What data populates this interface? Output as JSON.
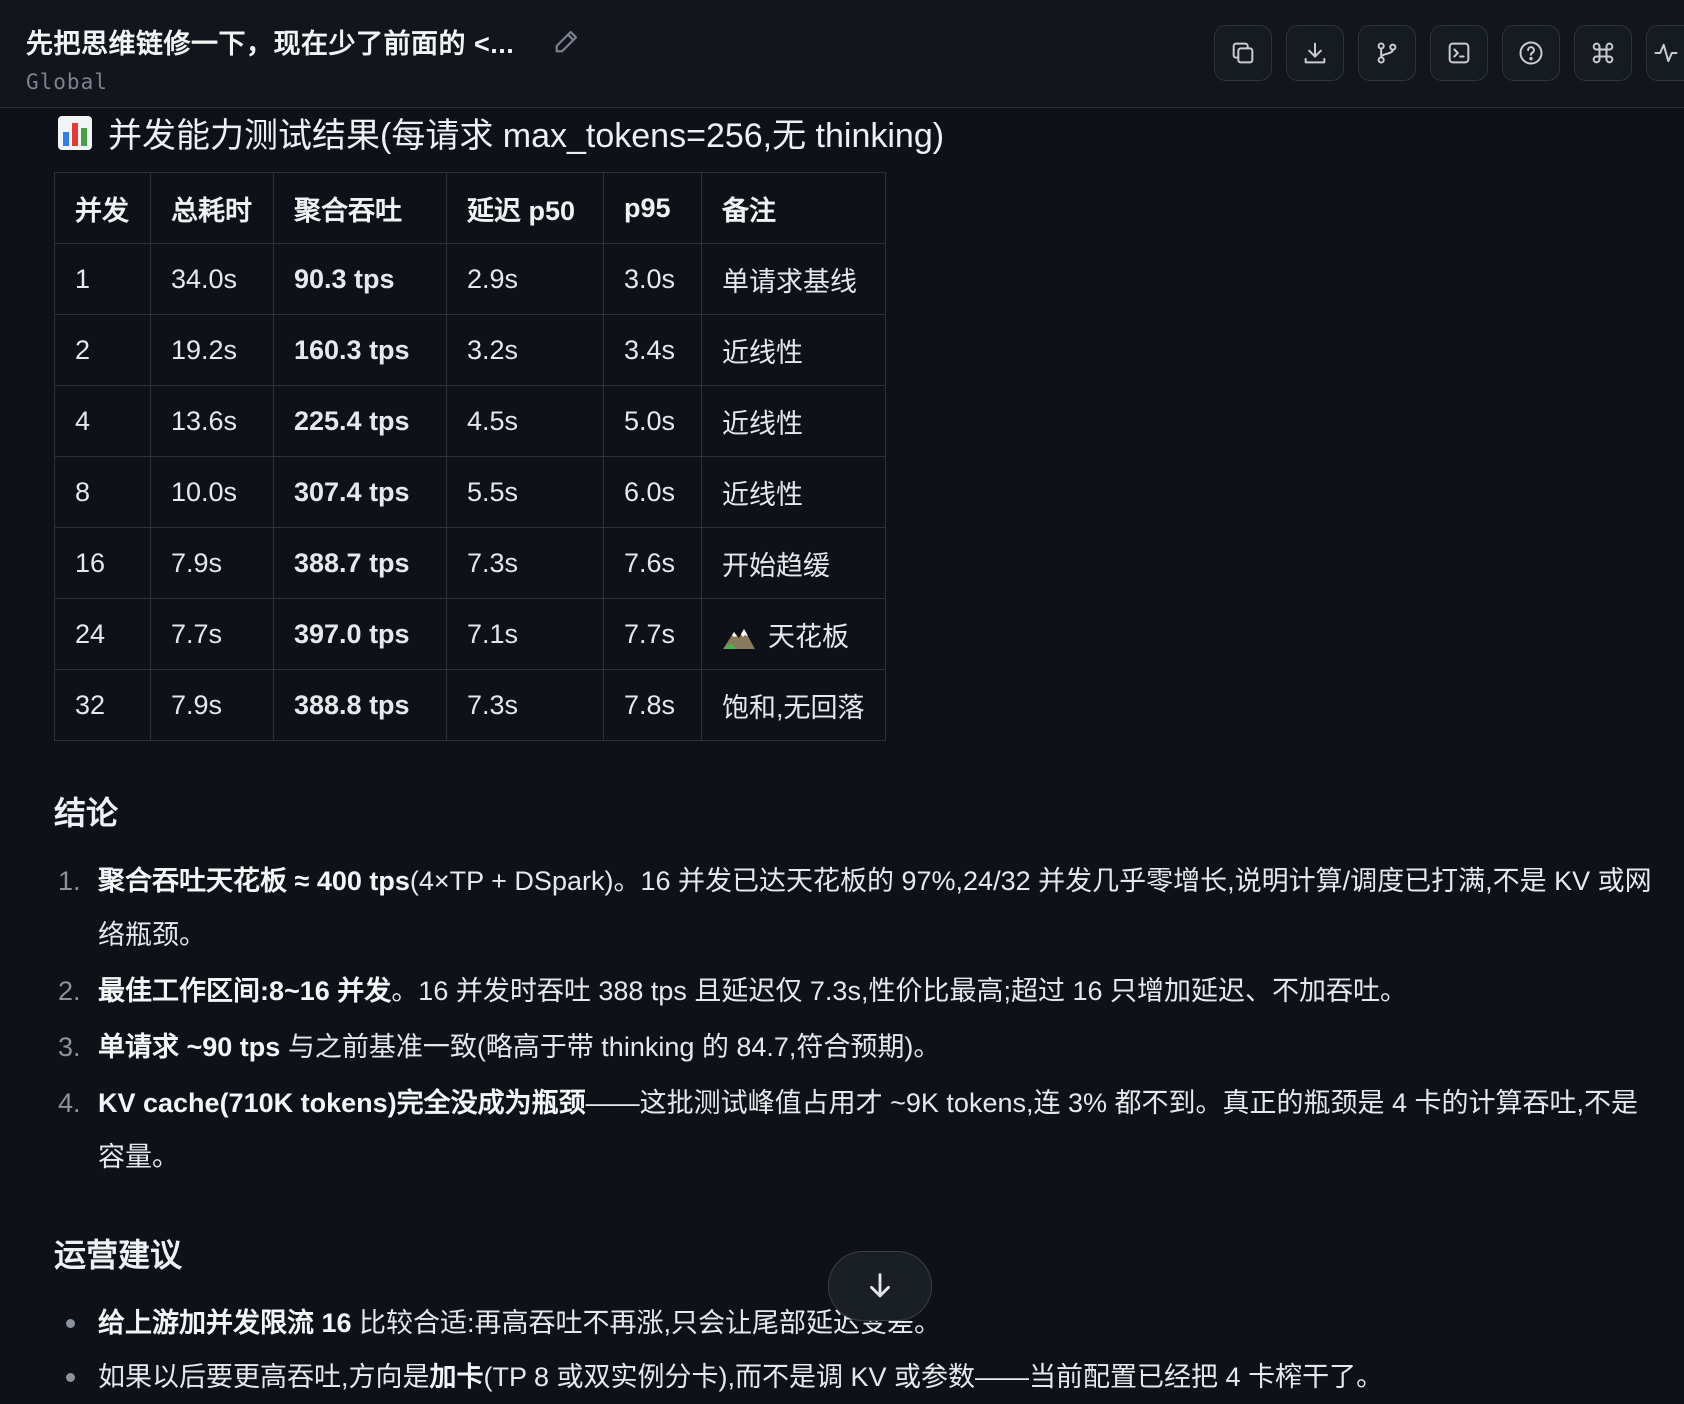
{
  "header": {
    "title": "先把思维链修一下，现在少了前面的 <...",
    "scope": "Global",
    "toolbar_icons": [
      "copy-icon",
      "download-icon",
      "branch-icon",
      "terminal-icon",
      "help-icon",
      "command-icon",
      "activity-icon"
    ]
  },
  "section_title": "并发能力测试结果(每请求 max_tokens=256,无 thinking)",
  "table": {
    "headers": [
      "并发",
      "总耗时",
      "聚合吞吐",
      "延迟 p50",
      "p95",
      "备注"
    ],
    "rows": [
      [
        "1",
        "34.0s",
        "90.3 tps",
        "2.9s",
        "3.0s",
        "单请求基线"
      ],
      [
        "2",
        "19.2s",
        "160.3 tps",
        "3.2s",
        "3.4s",
        "近线性"
      ],
      [
        "4",
        "13.6s",
        "225.4 tps",
        "4.5s",
        "5.0s",
        "近线性"
      ],
      [
        "8",
        "10.0s",
        "307.4 tps",
        "5.5s",
        "6.0s",
        "近线性"
      ],
      [
        "16",
        "7.9s",
        "388.7 tps",
        "7.3s",
        "7.6s",
        "开始趋缓"
      ],
      [
        "24",
        "7.7s",
        "397.0 tps",
        "7.1s",
        "7.7s",
        "天花板"
      ],
      [
        "32",
        "7.9s",
        "388.8 tps",
        "7.3s",
        "7.8s",
        "饱和,无回落"
      ]
    ]
  },
  "conclusion": {
    "title": "结论",
    "items": [
      {
        "num": "1.",
        "bold": "聚合吞吐天花板 ≈ 400 tps",
        "text": "(4×TP + DSpark)。16 并发已达天花板的 97%,24/32 并发几乎零增长,说明计算/调度已打满,不是 KV 或网络瓶颈。"
      },
      {
        "num": "2.",
        "bold": "最佳工作区间:8~16 并发",
        "text": "。16 并发时吞吐 388 tps 且延迟仅 7.3s,性价比最高;超过 16 只增加延迟、不加吞吐。"
      },
      {
        "num": "3.",
        "bold": "单请求 ~90 tps",
        "text": " 与之前基准一致(略高于带 thinking 的 84.7,符合预期)。"
      },
      {
        "num": "4.",
        "bold": "KV cache(710K tokens)完全没成为瓶颈",
        "text": "——这批测试峰值占用才 ~9K tokens,连 3% 都不到。真正的瓶颈是 4 卡的计算吞吐,不是容量。"
      }
    ]
  },
  "ops": {
    "title": "运营建议",
    "items": [
      {
        "bold": "给上游加并发限流 16",
        "text": " 比较合适:再高吞吐不再涨,只会让尾部延迟变差。"
      },
      {
        "pre": "如果以后要更高吞吐,方向是",
        "bold": "加卡",
        "text": "(TP 8 或双实例分卡),而不是调 KV 或参数——当前配置已经把 4 卡榨干了。"
      }
    ]
  }
}
